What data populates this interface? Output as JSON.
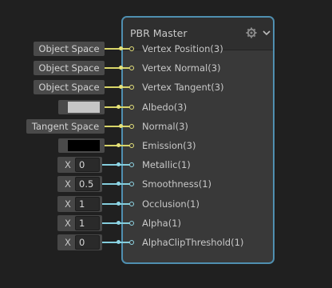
{
  "node": {
    "title": "PBR Master",
    "icons": {
      "settings": "gear-icon",
      "collapse": "chevron-down-icon"
    }
  },
  "slots": [
    {
      "label": "Vertex Position(3)",
      "port_color": "#e6e27a",
      "control": {
        "type": "space",
        "value": "Object Space"
      }
    },
    {
      "label": "Vertex Normal(3)",
      "port_color": "#e6e27a",
      "control": {
        "type": "space",
        "value": "Object Space"
      }
    },
    {
      "label": "Vertex Tangent(3)",
      "port_color": "#e6e27a",
      "control": {
        "type": "space",
        "value": "Object Space"
      }
    },
    {
      "label": "Albedo(3)",
      "port_color": "#e6e27a",
      "control": {
        "type": "color",
        "color": "#c6c6c6"
      }
    },
    {
      "label": "Normal(3)",
      "port_color": "#e6e27a",
      "control": {
        "type": "space",
        "value": "Tangent Space"
      }
    },
    {
      "label": "Emission(3)",
      "port_color": "#e6e27a",
      "control": {
        "type": "color",
        "color": "#000000"
      }
    },
    {
      "label": "Metallic(1)",
      "port_color": "#8fd6e6",
      "control": {
        "type": "float",
        "axis": "X",
        "value": "0"
      }
    },
    {
      "label": "Smoothness(1)",
      "port_color": "#8fd6e6",
      "control": {
        "type": "float",
        "axis": "X",
        "value": "0.5"
      }
    },
    {
      "label": "Occlusion(1)",
      "port_color": "#8fd6e6",
      "control": {
        "type": "float",
        "axis": "X",
        "value": "1"
      }
    },
    {
      "label": "Alpha(1)",
      "port_color": "#8fd6e6",
      "control": {
        "type": "float",
        "axis": "X",
        "value": "1"
      }
    },
    {
      "label": "AlphaClipThreshold(1)",
      "port_color": "#8fd6e6",
      "control": {
        "type": "float",
        "axis": "X",
        "value": "0"
      }
    }
  ]
}
